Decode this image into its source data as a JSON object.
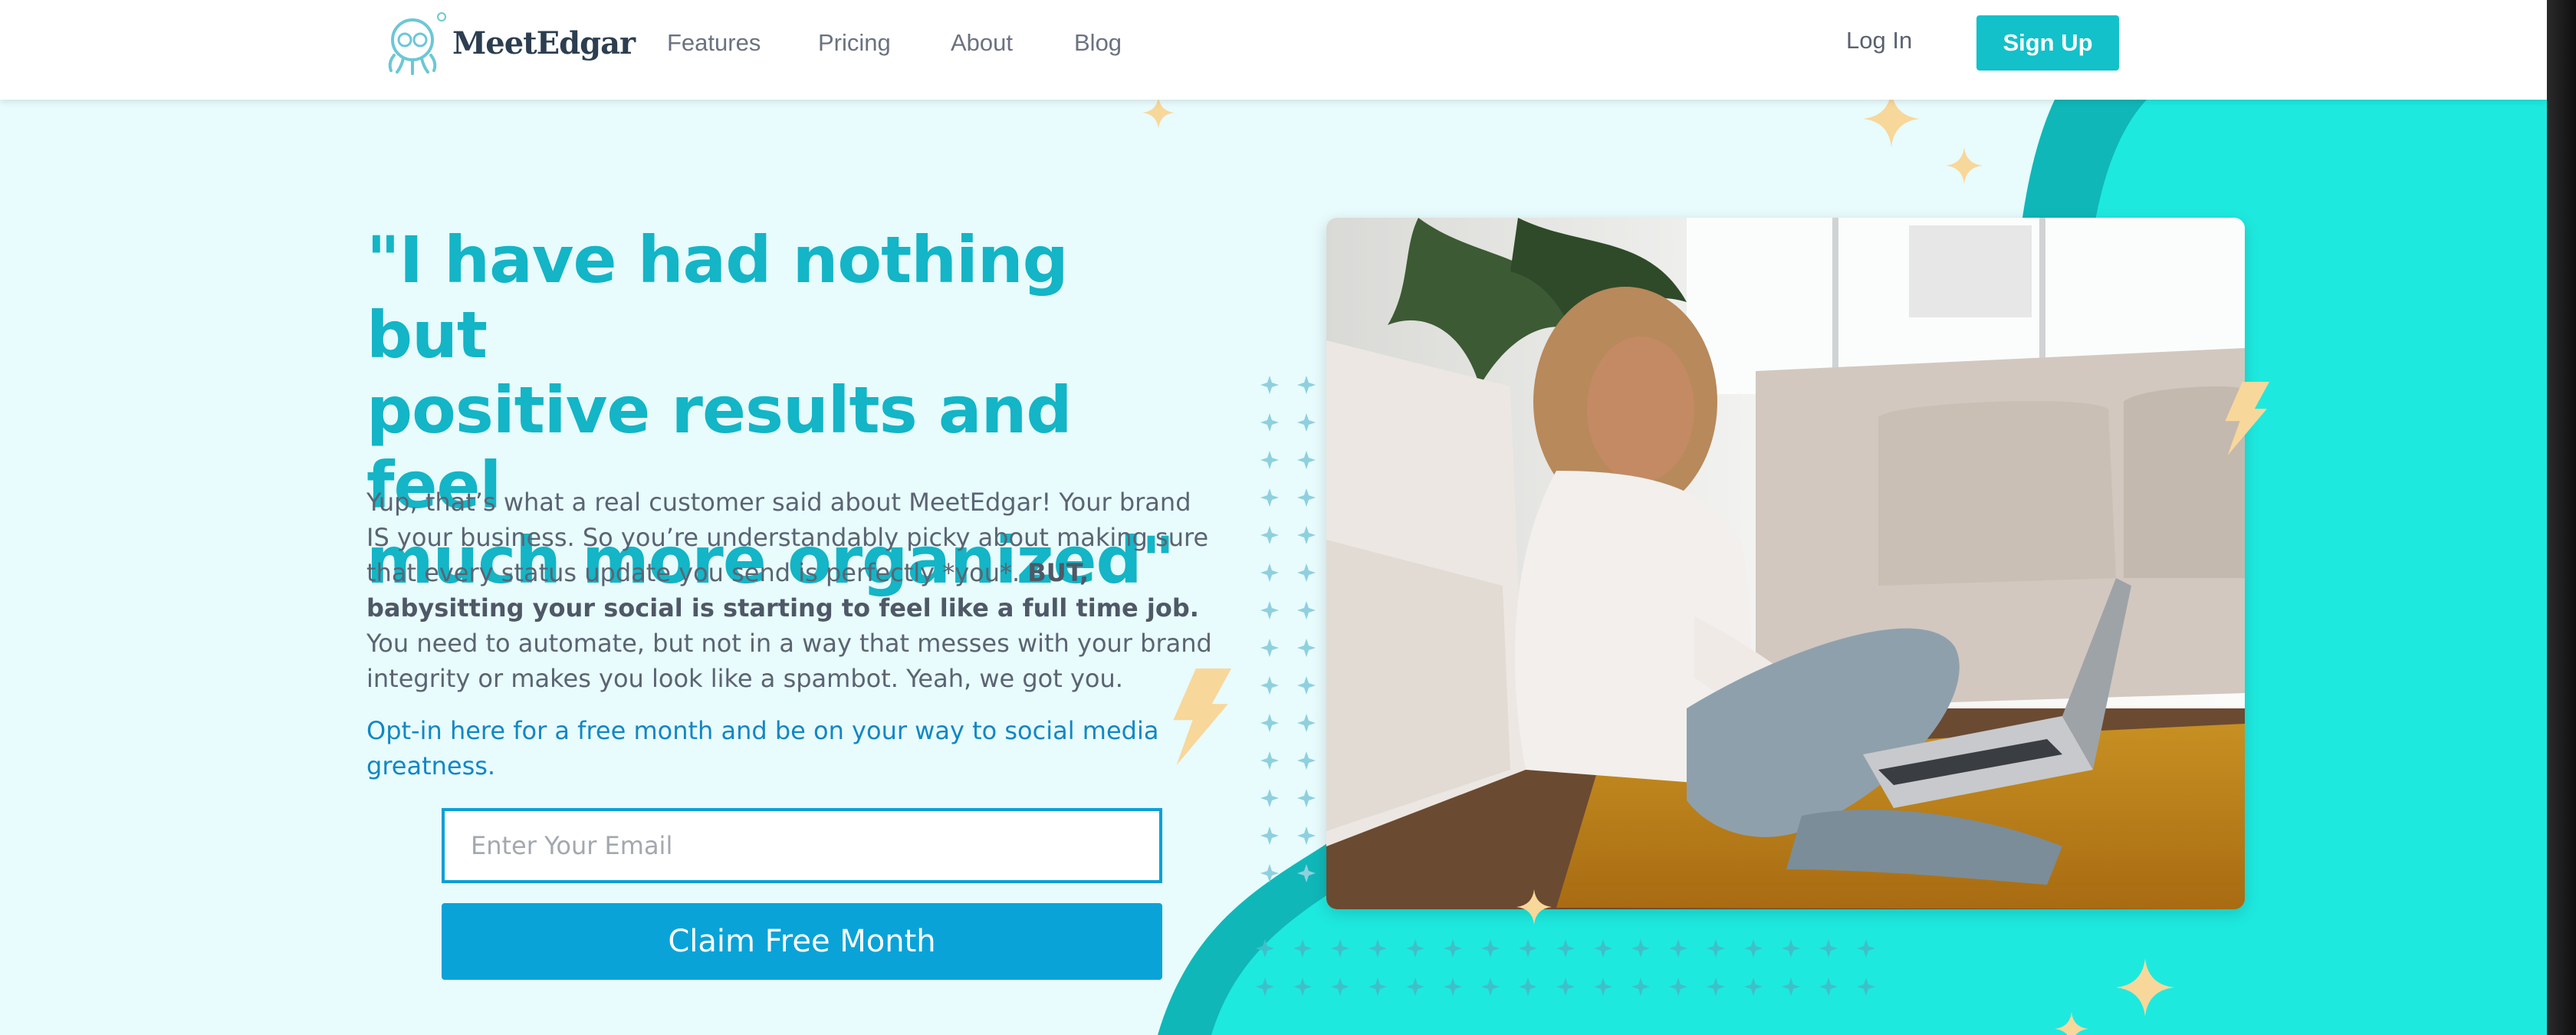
{
  "brand": {
    "name": "MeetEdgar",
    "logo_icon": "octopus-logo-icon"
  },
  "nav": {
    "items": [
      {
        "label": "Features"
      },
      {
        "label": "Pricing"
      },
      {
        "label": "About"
      },
      {
        "label": "Blog"
      }
    ],
    "login_label": "Log In",
    "signup_label": "Sign Up"
  },
  "hero": {
    "headline_lines": [
      "\"I have had nothing but",
      "positive results and feel",
      "much more organized\""
    ],
    "body": {
      "part1": "Yup, that’s what a real customer said about MeetEdgar! Your brand IS your business. So you’re understandably picky about making sure that every status update you send is perfectly *you*. ",
      "bold": " BUT, babysitting your social is starting to feel like a full time job.",
      "part2": " You need to automate, but not in a way that messes with your brand integrity or makes you look like a spambot. Yeah, we got you."
    },
    "optin": "Opt-in here for a free month and be on your way to social media greatness.",
    "email_placeholder": "Enter Your Email",
    "cta_label": "Claim Free Month"
  },
  "colors": {
    "brand_teal": "#12c1c9",
    "headline_teal": "#13b5c6",
    "cta_blue": "#0aa3d8",
    "background_light": "#e8fbfd",
    "wave_cyan": "#1de9e0",
    "sparkle_gold": "#f8d79a"
  },
  "icons": [
    "sparkle-icon",
    "lightning-bolt-icon",
    "plus-sparkle-icon"
  ]
}
